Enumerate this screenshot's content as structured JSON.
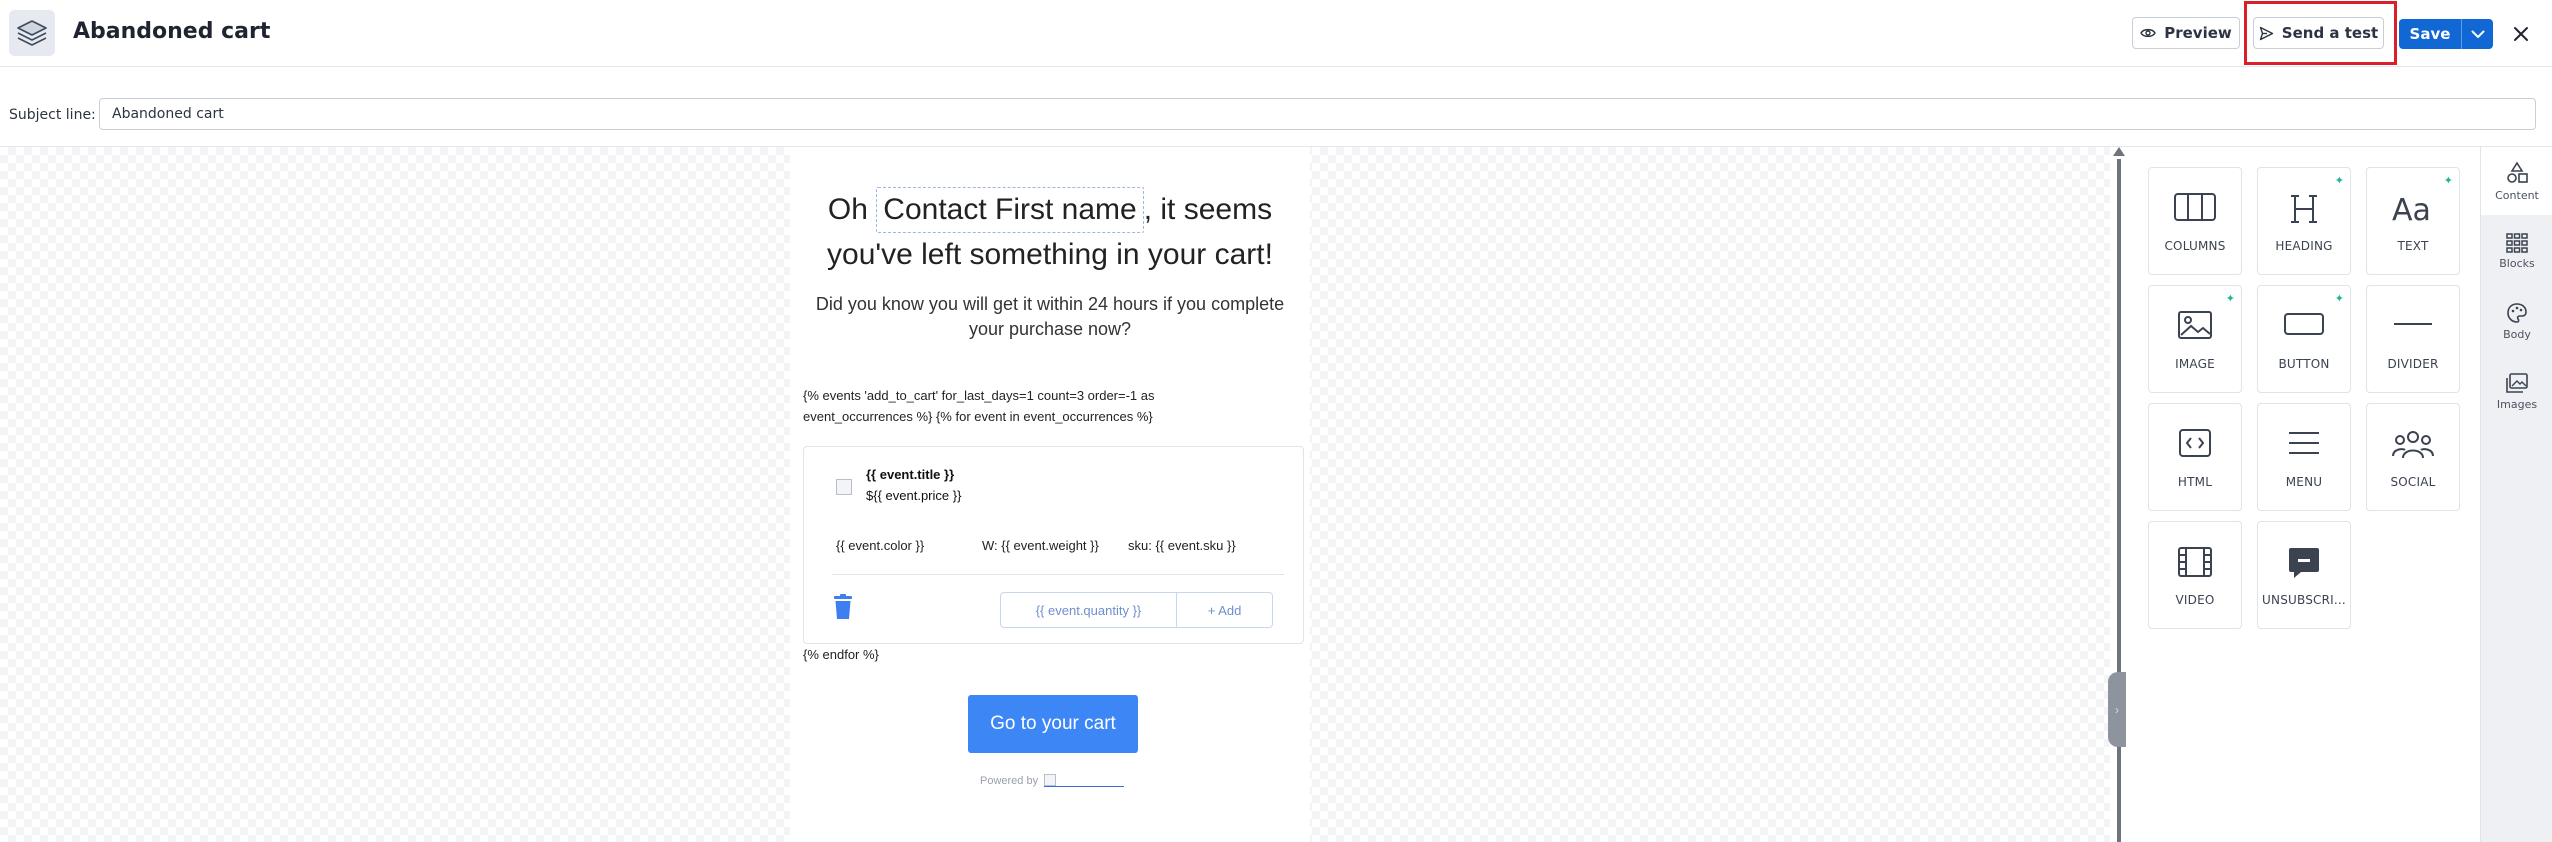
{
  "header": {
    "title": "Abandoned cart",
    "logo_icon": "layers-icon",
    "preview_label": "Preview",
    "send_test_label": "Send a test",
    "save_label": "Save",
    "close_icon": "close-icon"
  },
  "subject": {
    "label": "Subject line:",
    "value": "Abandoned cart"
  },
  "email": {
    "headline_prefix": "Oh",
    "headline_merge_tag": "Contact First name",
    "headline_suffix_1": ", it seems",
    "headline_line_2": "you've left something in your cart!",
    "subheading": "Did you know you will get it within 24 hours if you complete your purchase now?",
    "liquid_loop": "{% events 'add_to_cart' for_last_days=1 count=3 order=-1 as event_occurrences %} {% for event in event_occurrences %}",
    "product": {
      "title": "{{ event.title }}",
      "price": "${{ event.price }}",
      "color": "{{ event.color }}",
      "weight": "W: {{ event.weight }}",
      "sku": "sku: {{ event.sku }}",
      "quantity": "{{ event.quantity }}",
      "add_label": "+ Add"
    },
    "endfor": "{% endfor %}",
    "cta_label": "Go to your cart",
    "powered_by": "Powered by"
  },
  "blocks": [
    {
      "label": "COLUMNS",
      "icon": "columns-icon",
      "ai": false
    },
    {
      "label": "HEADING",
      "icon": "heading-icon",
      "ai": true
    },
    {
      "label": "TEXT",
      "icon": "text-icon",
      "ai": true
    },
    {
      "label": "IMAGE",
      "icon": "image-icon",
      "ai": true
    },
    {
      "label": "BUTTON",
      "icon": "button-icon",
      "ai": true
    },
    {
      "label": "DIVIDER",
      "icon": "divider-icon",
      "ai": false
    },
    {
      "label": "HTML",
      "icon": "html-icon",
      "ai": false
    },
    {
      "label": "MENU",
      "icon": "menu-icon",
      "ai": false
    },
    {
      "label": "SOCIAL",
      "icon": "social-icon",
      "ai": false
    },
    {
      "label": "VIDEO",
      "icon": "video-icon",
      "ai": false
    },
    {
      "label": "UNSUBSCRI...",
      "icon": "unsubscribe-icon",
      "ai": false
    }
  ],
  "side_tabs": [
    {
      "label": "Content",
      "icon": "shapes-icon",
      "active": true
    },
    {
      "label": "Blocks",
      "icon": "grid-icon",
      "active": false
    },
    {
      "label": "Body",
      "icon": "palette-icon",
      "active": false
    },
    {
      "label": "Images",
      "icon": "images-icon",
      "active": false
    }
  ],
  "colors": {
    "primary": "#1167d4",
    "cta": "#3d86f5",
    "highlight": "#d9202a",
    "ai_sparkle": "#1fb39a"
  }
}
